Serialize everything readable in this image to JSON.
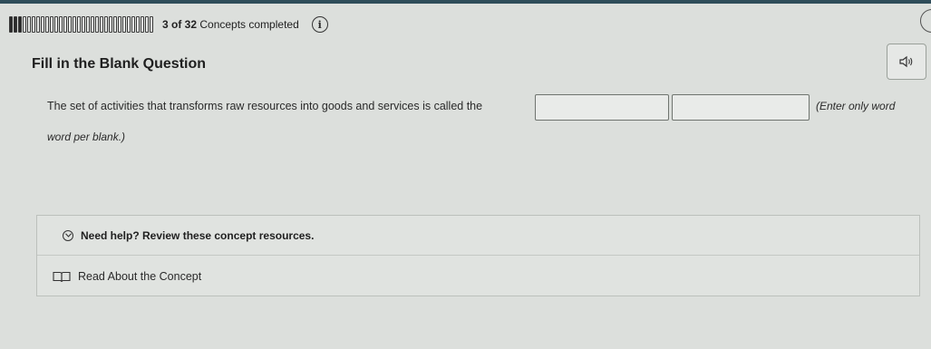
{
  "progress": {
    "completed": 3,
    "total": 32,
    "count_text": "3 of 32",
    "rest_text": "Concepts completed"
  },
  "question": {
    "title": "Fill in the Blank Question",
    "sentence": "The set of activities that transforms raw resources into goods and services is called the",
    "blanks": [
      "",
      ""
    ],
    "hint_line1": "(Enter only word",
    "hint_line2": "word per blank.)"
  },
  "help": {
    "header": "Need help? Review these concept resources.",
    "link_label": "Read About the Concept"
  },
  "icons": {
    "info": "info-icon",
    "audio": "speaker-icon",
    "expand": "chevron-circle-icon",
    "book": "book-icon"
  },
  "colors": {
    "topbar": "#2f4d5a",
    "background": "#dcdfdc"
  }
}
